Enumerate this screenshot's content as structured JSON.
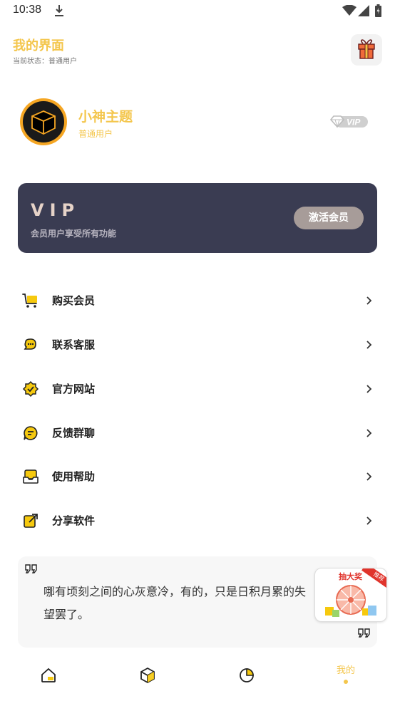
{
  "status_bar": {
    "time": "10:38"
  },
  "header": {
    "title": "我的界面",
    "subtitle": "当前状态：普通用户"
  },
  "profile": {
    "name": "小神主题",
    "level": "普通用户",
    "badge": "VIP"
  },
  "vip_card": {
    "title": "VIP",
    "description": "会员用户享受所有功能",
    "button_label": "激活会员"
  },
  "menu": [
    {
      "label": "购买会员",
      "icon": "cart-icon"
    },
    {
      "label": "联系客服",
      "icon": "chat-icon"
    },
    {
      "label": "官方网站",
      "icon": "verified-badge-icon"
    },
    {
      "label": "反馈群聊",
      "icon": "message-icon"
    },
    {
      "label": "使用帮助",
      "icon": "inbox-icon"
    },
    {
      "label": "分享软件",
      "icon": "share-icon"
    }
  ],
  "quote": {
    "text": "哪有顷刻之间的心灰意冷，有的，只是日积月累的失望罢了。"
  },
  "lottery": {
    "label": "抽大奖",
    "tag": "推荐"
  },
  "bottom_nav": {
    "items": [
      {
        "icon": "home-icon"
      },
      {
        "icon": "cube-icon"
      },
      {
        "icon": "pie-chart-icon"
      },
      {
        "label": "我的"
      }
    ]
  },
  "colors": {
    "accent": "#f4c64c",
    "card_bg": "#3a3c52",
    "button_bg": "#a79c99"
  }
}
